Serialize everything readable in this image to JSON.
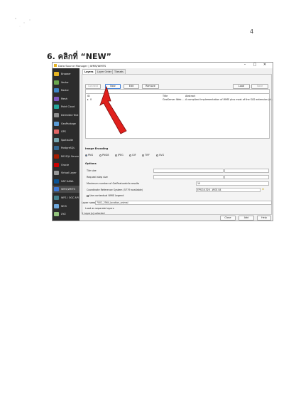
{
  "page": {
    "number": "4",
    "heading": "6. คลิกที่ “NEW”"
  },
  "dialog": {
    "title": "Data Source Manager | WMS/WMTS",
    "window_buttons": [
      "–",
      "□",
      "✕"
    ],
    "sidebar": [
      {
        "label": "Browser",
        "icon": "folder-icon",
        "color": "#e6b422"
      },
      {
        "label": "Vector",
        "icon": "vector-icon",
        "color": "#6aa84f"
      },
      {
        "label": "Raster",
        "icon": "raster-icon",
        "color": "#3d85c6"
      },
      {
        "label": "Mesh",
        "icon": "mesh-icon",
        "color": "#7e57c2"
      },
      {
        "label": "Point Cloud",
        "icon": "point-cloud-icon",
        "color": "#26a69a"
      },
      {
        "label": "Delimited Text",
        "icon": "delimited-text-icon",
        "color": "#8e8e8e"
      },
      {
        "label": "GeoPackage",
        "icon": "geopackage-icon",
        "color": "#5b9bd5"
      },
      {
        "label": "GPS",
        "icon": "gps-icon",
        "color": "#e06666"
      },
      {
        "label": "SpatiaLite",
        "icon": "spatialite-icon",
        "color": "#76a5af"
      },
      {
        "label": "PostgreSQL",
        "icon": "postgresql-icon",
        "color": "#336791"
      },
      {
        "label": "MS SQL Server",
        "icon": "mssql-icon",
        "color": "#a61c00"
      },
      {
        "label": "Oracle",
        "icon": "oracle-icon",
        "color": "#cc0000"
      },
      {
        "label": "Virtual Layer",
        "icon": "virtual-layer-icon",
        "color": "#999999"
      },
      {
        "label": "SAP HANA",
        "icon": "sap-hana-icon",
        "color": "#0b5394"
      },
      {
        "label": "WMS/WMTS",
        "icon": "wms-icon",
        "color": "#3c78d8"
      },
      {
        "label": "WFS / OGC API - Features",
        "icon": "wfs-icon",
        "color": "#45818e"
      },
      {
        "label": "WCS",
        "icon": "wcs-icon",
        "color": "#6fa8dc"
      },
      {
        "label": "XYZ",
        "icon": "xyz-icon",
        "color": "#93c47d"
      }
    ],
    "tabs": [
      "Layers",
      "Layer Order",
      "Tilesets"
    ],
    "connection_buttons": {
      "connect": "Connect",
      "new": "New",
      "edit": "Edit",
      "remove": "Remove",
      "load": "Load",
      "save": "Save"
    },
    "tree_headers": {
      "id": "ID",
      "name": "Na",
      "title": "Title",
      "abstract": "Abstract"
    },
    "tree_rows": [
      {
        "id": "0",
        "title": "GeoServer Web ...",
        "abstract": "A compliant implementation of WMS plus most of the SLD extension (d..."
      }
    ],
    "image_encoding": {
      "label": "Image Encoding",
      "formats": [
        "PNG",
        "PNG8",
        "JPEG",
        "GIF",
        "TIFF",
        "SVG"
      ],
      "selected": "PNG"
    },
    "options": {
      "label": "Options",
      "tile_size": "Tile size",
      "step_size": "Request step size",
      "max_features": "Maximum number of GetFeatureInfo results",
      "max_features_value": "10",
      "crs_label": "Coordinate Reference System (5779 available)",
      "crs_value": "EPSG:4326 - WGS 84",
      "legend": "Use contextual WMS Legend"
    },
    "layer_name": {
      "label": "Layer name",
      "value": "7002_2564_location_animal"
    },
    "load_separate": "Load as separate layers",
    "status": "1 Layer(s) selected",
    "footer_buttons": {
      "close": "Close",
      "add": "Add",
      "help": "Help"
    }
  }
}
